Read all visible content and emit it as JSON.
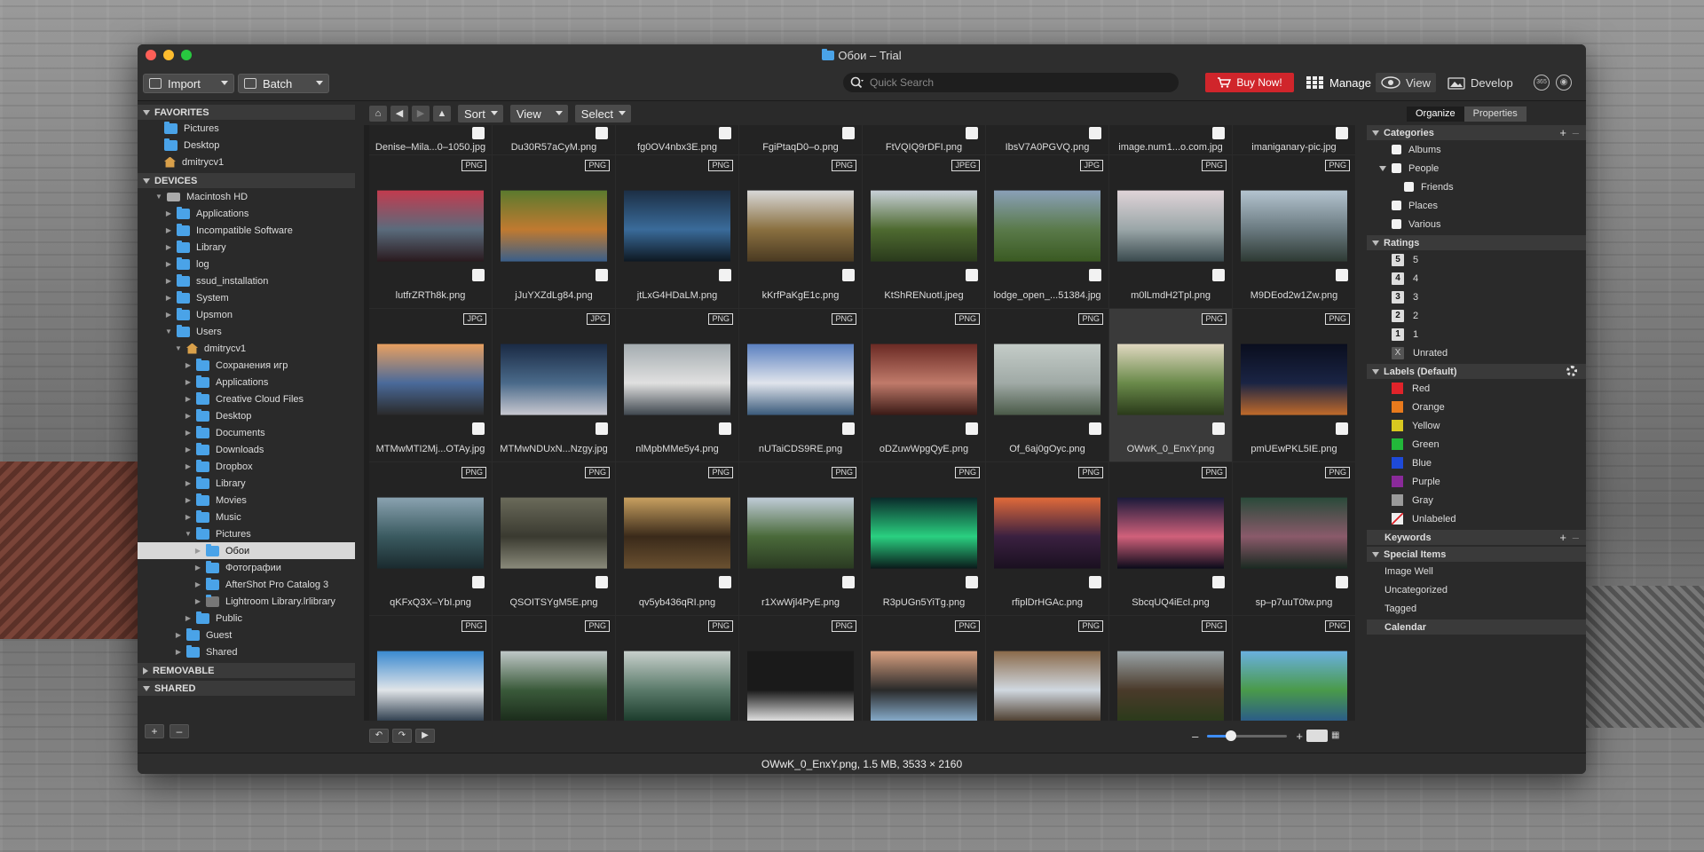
{
  "window": {
    "title": "Обои – Trial"
  },
  "toolbar": {
    "import_label": "Import",
    "batch_label": "Batch",
    "search_placeholder": "Quick Search",
    "buy_label": "Buy Now!",
    "manage_label": "Manage",
    "view_label": "View",
    "develop_label": "Develop",
    "badge_365": "365"
  },
  "sidebar": {
    "favorites_label": "FAVORITES",
    "favorites": [
      "Pictures",
      "Desktop",
      "dmitrycv1"
    ],
    "devices_label": "DEVICES",
    "tree": [
      {
        "label": "Macintosh HD",
        "level": 1,
        "open": true,
        "kind": "hdd"
      },
      {
        "label": "Applications",
        "level": 2,
        "open": false,
        "kind": "folder"
      },
      {
        "label": "Incompatible Software",
        "level": 2,
        "open": false,
        "kind": "folder"
      },
      {
        "label": "Library",
        "level": 2,
        "open": false,
        "kind": "folder"
      },
      {
        "label": "log",
        "level": 2,
        "open": false,
        "kind": "folder"
      },
      {
        "label": "ssud_installation",
        "level": 2,
        "open": false,
        "kind": "folder"
      },
      {
        "label": "System",
        "level": 2,
        "open": false,
        "kind": "folder"
      },
      {
        "label": "Upsmon",
        "level": 2,
        "open": false,
        "kind": "folder"
      },
      {
        "label": "Users",
        "level": 2,
        "open": true,
        "kind": "folder"
      },
      {
        "label": "dmitrycv1",
        "level": 3,
        "open": true,
        "kind": "home"
      },
      {
        "label": "Сохранения игр",
        "level": 4,
        "open": false,
        "kind": "folder"
      },
      {
        "label": "Applications",
        "level": 4,
        "open": false,
        "kind": "folder"
      },
      {
        "label": "Creative Cloud Files",
        "level": 4,
        "open": false,
        "kind": "folder"
      },
      {
        "label": "Desktop",
        "level": 4,
        "open": false,
        "kind": "folder"
      },
      {
        "label": "Documents",
        "level": 4,
        "open": false,
        "kind": "folder"
      },
      {
        "label": "Downloads",
        "level": 4,
        "open": false,
        "kind": "folder"
      },
      {
        "label": "Dropbox",
        "level": 4,
        "open": false,
        "kind": "folder"
      },
      {
        "label": "Library",
        "level": 4,
        "open": false,
        "kind": "folder"
      },
      {
        "label": "Movies",
        "level": 4,
        "open": false,
        "kind": "folder"
      },
      {
        "label": "Music",
        "level": 4,
        "open": false,
        "kind": "folder"
      },
      {
        "label": "Pictures",
        "level": 4,
        "open": true,
        "kind": "folder"
      },
      {
        "label": "Обои",
        "level": 5,
        "open": false,
        "kind": "folder",
        "selected": true
      },
      {
        "label": "Фотографии",
        "level": 5,
        "open": false,
        "kind": "folder"
      },
      {
        "label": "AfterShot Pro Catalog 3",
        "level": 5,
        "open": false,
        "kind": "folder"
      },
      {
        "label": "Lightroom Library.lrlibrary",
        "level": 5,
        "open": false,
        "kind": "lib"
      },
      {
        "label": "Public",
        "level": 4,
        "open": false,
        "kind": "folder"
      },
      {
        "label": "Guest",
        "level": 3,
        "open": false,
        "kind": "folder"
      },
      {
        "label": "Shared",
        "level": 3,
        "open": false,
        "kind": "folder"
      }
    ],
    "removable_label": "REMOVABLE",
    "shared_label": "SHARED"
  },
  "nav": {
    "sort_label": "Sort",
    "view_label": "View",
    "select_label": "Select"
  },
  "top_row_names": [
    "Denise–Mila...0–1050.jpg",
    "Du30R57aCyM.png",
    "fg0OV4nbx3E.png",
    "FgiPtaqD0–o.png",
    "FtVQIQ9rDFI.png",
    "IbsV7A0PGVQ.png",
    "image.num1...o.com.jpg",
    "imaniganary-pic.jpg"
  ],
  "files": [
    {
      "name": "lutfrZRTh8k.png",
      "type": "PNG",
      "colors": [
        "#c23b4e",
        "#5a6b7c",
        "#2a1a1e"
      ]
    },
    {
      "name": "jJuYXZdLg84.png",
      "type": "PNG",
      "colors": [
        "#5b7a2e",
        "#c07a30",
        "#3a5f8a"
      ]
    },
    {
      "name": "jtLxG4HDaLM.png",
      "type": "PNG",
      "colors": [
        "#1c2f45",
        "#3a6b9a",
        "#0e1822"
      ]
    },
    {
      "name": "kKrfPaKgE1c.png",
      "type": "PNG",
      "colors": [
        "#d8d8d8",
        "#8a7040",
        "#4a3a22"
      ]
    },
    {
      "name": "KtShRENuotI.jpeg",
      "type": "JPEG",
      "colors": [
        "#c8d0d8",
        "#4e6a30",
        "#2a3a1c"
      ]
    },
    {
      "name": "lodge_open_...51384.jpg",
      "type": "JPG",
      "colors": [
        "#8aa0b8",
        "#5a7a4a",
        "#3a5a22"
      ]
    },
    {
      "name": "m0lLmdH2Tpl.png",
      "type": "PNG",
      "colors": [
        "#e0d4d8",
        "#9aa6a8",
        "#3a4a4e"
      ]
    },
    {
      "name": "M9DEod2w1Zw.png",
      "type": "PNG",
      "colors": [
        "#b4c4d0",
        "#6a7a80",
        "#2e3a34"
      ]
    },
    {
      "name": "MTMwMTI2Mj...OTAy.jpg",
      "type": "JPG",
      "colors": [
        "#e8a060",
        "#4a6a9a",
        "#2a2a2a"
      ]
    },
    {
      "name": "MTMwNDUxN...Nzgy.jpg",
      "type": "JPG",
      "colors": [
        "#1a2a44",
        "#4a6a8a",
        "#c8c8d0"
      ]
    },
    {
      "name": "nlMpbMMe5y4.png",
      "type": "PNG",
      "colors": [
        "#a4acb0",
        "#e0e0e0",
        "#404850"
      ]
    },
    {
      "name": "nUTaiCDS9RE.png",
      "type": "PNG",
      "colors": [
        "#5a80c0",
        "#e0e4ec",
        "#3a5a7a"
      ]
    },
    {
      "name": "oDZuwWpgQyE.png",
      "type": "PNG",
      "colors": [
        "#6a2a24",
        "#c07a6a",
        "#3a1a16"
      ]
    },
    {
      "name": "Of_6aj0gOyc.png",
      "type": "PNG",
      "colors": [
        "#c4ccc8",
        "#a0aaa6",
        "#4a5a48"
      ]
    },
    {
      "name": "OWwK_0_EnxY.png",
      "type": "PNG",
      "colors": [
        "#e0d8c0",
        "#6a8a4a",
        "#2a3a1a"
      ],
      "selected": true
    },
    {
      "name": "pmUEwPKL5IE.png",
      "type": "PNG",
      "colors": [
        "#0a0e1e",
        "#1a2444",
        "#c06a2a"
      ]
    },
    {
      "name": "qKFxQ3X–YbI.png",
      "type": "PNG",
      "colors": [
        "#8aa2b0",
        "#3a5a60",
        "#1a2a2e"
      ]
    },
    {
      "name": "QSOITSYgM5E.png",
      "type": "PNG",
      "colors": [
        "#6a6a5a",
        "#3a3a30",
        "#8a8a7a"
      ]
    },
    {
      "name": "qv5yb436qRI.png",
      "type": "PNG",
      "colors": [
        "#c8a060",
        "#3a2a1a",
        "#6a5030"
      ]
    },
    {
      "name": "r1XwWjl4PyE.png",
      "type": "PNG",
      "colors": [
        "#c0ccd8",
        "#4a6a3a",
        "#2a3a22"
      ]
    },
    {
      "name": "R3pUGn5YiTg.png",
      "type": "PNG",
      "colors": [
        "#0a2a2a",
        "#2ad080",
        "#0a1a1a"
      ]
    },
    {
      "name": "rfiplDrHGAc.png",
      "type": "PNG",
      "colors": [
        "#e06a3a",
        "#3a2040",
        "#1a1020"
      ]
    },
    {
      "name": "SbcqUQ4iEcI.png",
      "type": "PNG",
      "colors": [
        "#1a1a3a",
        "#d0607a",
        "#0a0a1a"
      ]
    },
    {
      "name": "sp–p7uuT0tw.png",
      "type": "PNG",
      "colors": [
        "#2a4a3a",
        "#8a5a6a",
        "#1a2a22"
      ]
    },
    {
      "name": "",
      "type": "PNG",
      "colors": [
        "#3a8ad0",
        "#e0e4e8",
        "#2a3a4a"
      ]
    },
    {
      "name": "",
      "type": "PNG",
      "colors": [
        "#c0c8c8",
        "#3a5a3a",
        "#1a2a1a"
      ]
    },
    {
      "name": "",
      "type": "PNG",
      "colors": [
        "#c8d0cc",
        "#5a7a6a",
        "#1a3a2a"
      ]
    },
    {
      "name": "",
      "type": "PNG",
      "colors": [
        "#1a1a1a",
        "#1a1a1a",
        "#e8e8e8"
      ]
    },
    {
      "name": "",
      "type": "PNG",
      "colors": [
        "#d8a080",
        "#2a2a2a",
        "#8ab0d0"
      ]
    },
    {
      "name": "",
      "type": "PNG",
      "colors": [
        "#8a6a4a",
        "#d0d8e0",
        "#4a3a2a"
      ]
    },
    {
      "name": "",
      "type": "PNG",
      "colors": [
        "#9aa4a8",
        "#4a3a2a",
        "#2a3a1a"
      ]
    },
    {
      "name": "",
      "type": "PNG",
      "colors": [
        "#6ab0e0",
        "#4a9a4a",
        "#2a5a8a"
      ]
    }
  ],
  "right_panel": {
    "organize_tab": "Organize",
    "properties_tab": "Properties",
    "categories_label": "Categories",
    "categories": [
      {
        "label": "Albums",
        "indent": false
      },
      {
        "label": "People",
        "indent": false,
        "open": true
      },
      {
        "label": "Friends",
        "indent": true
      },
      {
        "label": "Places",
        "indent": false
      },
      {
        "label": "Various",
        "indent": false
      }
    ],
    "ratings_label": "Ratings",
    "ratings": [
      {
        "num": "5",
        "label": "5"
      },
      {
        "num": "4",
        "label": "4"
      },
      {
        "num": "3",
        "label": "3"
      },
      {
        "num": "2",
        "label": "2"
      },
      {
        "num": "1",
        "label": "1"
      },
      {
        "num": "X",
        "label": "Unrated"
      }
    ],
    "labels_label": "Labels (Default)",
    "labels": [
      {
        "label": "Red",
        "color": "#e0232a"
      },
      {
        "label": "Orange",
        "color": "#e87a1c"
      },
      {
        "label": "Yellow",
        "color": "#d8c820"
      },
      {
        "label": "Green",
        "color": "#22b83a"
      },
      {
        "label": "Blue",
        "color": "#1e4ad8"
      },
      {
        "label": "Purple",
        "color": "#8a2a9a"
      },
      {
        "label": "Gray",
        "color": "#9a9a9a"
      },
      {
        "label": "Unlabeled",
        "color": "none"
      }
    ],
    "keywords_label": "Keywords",
    "special_label": "Special Items",
    "special": [
      "Image Well",
      "Uncategorized",
      "Tagged"
    ],
    "calendar_label": "Calendar"
  },
  "status_bar": {
    "text": "OWwK_0_EnxY.png, 1.5 MB, 3533 × 2160"
  },
  "zoom": {
    "minus": "–",
    "plus": "+",
    "level": 0.3
  }
}
